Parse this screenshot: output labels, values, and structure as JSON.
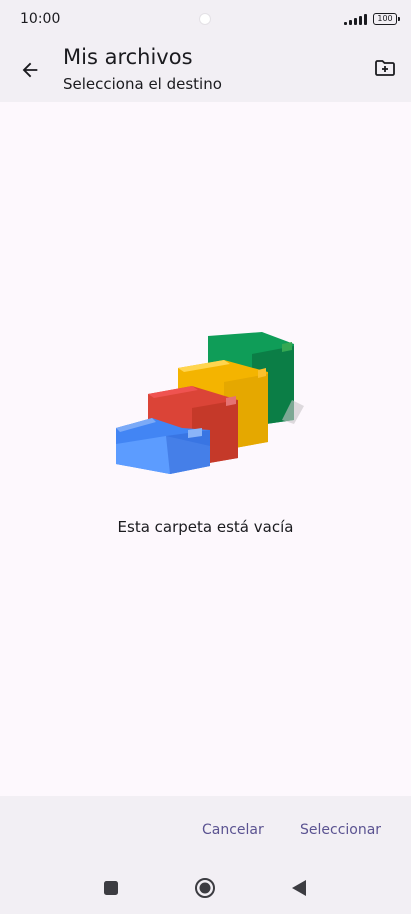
{
  "status_bar": {
    "time": "10:00",
    "battery": "100",
    "icons": [
      "signal-icon",
      "battery-icon"
    ]
  },
  "app_bar": {
    "title": "Mis archivos",
    "subtitle": "Selecciona el destino",
    "icons": [
      "back-arrow-icon",
      "new-folder-icon"
    ]
  },
  "content": {
    "empty_message": "Esta carpeta está vacía",
    "illustration_colors": [
      "#4285f4",
      "#db4437",
      "#f4b400",
      "#0f9d58"
    ]
  },
  "actions": {
    "cancel_label": "Cancelar",
    "select_label": "Seleccionar"
  },
  "nav": {
    "icons": [
      "recents-icon",
      "home-icon",
      "back-icon"
    ]
  },
  "colors": {
    "accent": "#5b5391",
    "bar_background": "#f2eff4",
    "page_background": "#fdf8fd"
  }
}
